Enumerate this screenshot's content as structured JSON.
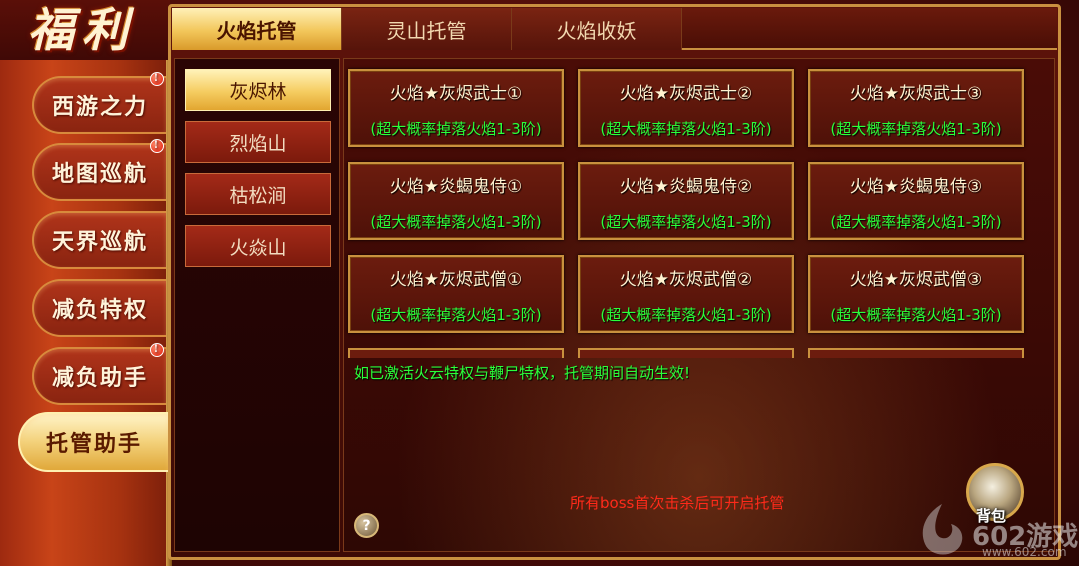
{
  "panel": {
    "title": "福利"
  },
  "sidebar": {
    "items": [
      {
        "label": "西游之力",
        "badge": "!"
      },
      {
        "label": "地图巡航",
        "badge": "!"
      },
      {
        "label": "天界巡航",
        "badge": ""
      },
      {
        "label": "减负特权",
        "badge": ""
      },
      {
        "label": "减负助手",
        "badge": "!"
      },
      {
        "label": "托管助手",
        "badge": "",
        "active": true
      }
    ]
  },
  "tabs": [
    {
      "label": "火焰托管",
      "active": true
    },
    {
      "label": "灵山托管"
    },
    {
      "label": "火焰收妖"
    }
  ],
  "maps": [
    {
      "label": "灰烬林",
      "active": true
    },
    {
      "label": "烈焰山"
    },
    {
      "label": "枯松涧"
    },
    {
      "label": "火焱山"
    }
  ],
  "cards": [
    {
      "name": "火焰★灰烬武士①",
      "drop": "(超大概率掉落火焰1-3阶)"
    },
    {
      "name": "火焰★灰烬武士②",
      "drop": "(超大概率掉落火焰1-3阶)"
    },
    {
      "name": "火焰★灰烬武士③",
      "drop": "(超大概率掉落火焰1-3阶)"
    },
    {
      "name": "火焰★炎蝎鬼侍①",
      "drop": "(超大概率掉落火焰1-3阶)"
    },
    {
      "name": "火焰★炎蝎鬼侍②",
      "drop": "(超大概率掉落火焰1-3阶)"
    },
    {
      "name": "火焰★炎蝎鬼侍③",
      "drop": "(超大概率掉落火焰1-3阶)"
    },
    {
      "name": "火焰★灰烬武僧①",
      "drop": "(超大概率掉落火焰1-3阶)"
    },
    {
      "name": "火焰★灰烬武僧②",
      "drop": "(超大概率掉落火焰1-3阶)"
    },
    {
      "name": "火焰★灰烬武僧③",
      "drop": "(超大概率掉落火焰1-3阶)"
    }
  ],
  "notice": "如已激活火云特权与鞭尸特权，托管期间自动生效!",
  "boss_note": "所有boss首次击杀后可开启托管",
  "help": {
    "label": "?"
  },
  "bag": {
    "label": "背包"
  },
  "watermark": {
    "text": "602游戏",
    "url": "www.602.com"
  },
  "colors": {
    "gold": "#c9913e",
    "drop_green": "#2bff3a",
    "note_red": "#ff2a1a"
  }
}
